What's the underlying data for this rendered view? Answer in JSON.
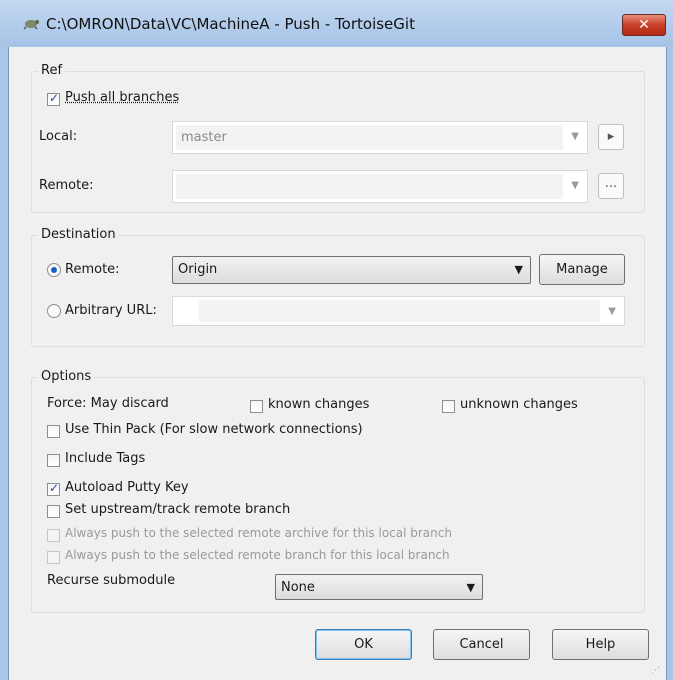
{
  "window": {
    "title": "C:\\OMRON\\Data\\VC\\MachineA - Push - TortoiseGit",
    "close_label": "✕"
  },
  "ref": {
    "group_label": "Ref",
    "push_all_label": "Push all branches",
    "push_all_checked": true,
    "local_label": "Local:",
    "local_value": "master",
    "remote_label": "Remote:",
    "remote_value": "",
    "local_browse_label": "▸",
    "remote_browse_label": "..."
  },
  "destination": {
    "group_label": "Destination",
    "remote_radio_label": "Remote:",
    "remote_selected": true,
    "remote_value": "Origin",
    "manage_label": "Manage",
    "url_radio_label": "Arbitrary URL:",
    "url_value": ""
  },
  "options": {
    "group_label": "Options",
    "force_label": "Force: May discard",
    "known_changes_label": "known changes",
    "unknown_changes_label": "unknown changes",
    "thin_pack_label": "Use Thin Pack (For slow network connections)",
    "include_tags_label": "Include Tags",
    "autoload_label": "Autoload Putty Key",
    "autoload_checked": true,
    "set_upstream_label": "Set upstream/track remote branch",
    "always_archive_label": "Always push to the selected remote archive for this local branch",
    "always_branch_label": "Always push to the selected remote branch for this local branch",
    "recurse_label": "Recurse submodule",
    "recurse_value": "None"
  },
  "buttons": {
    "ok": "OK",
    "cancel": "Cancel",
    "help": "Help"
  },
  "colors": {
    "titlebar": "#a9c6e8",
    "close_button": "#c7402a",
    "dialog_bg": "#f0f0f0"
  }
}
